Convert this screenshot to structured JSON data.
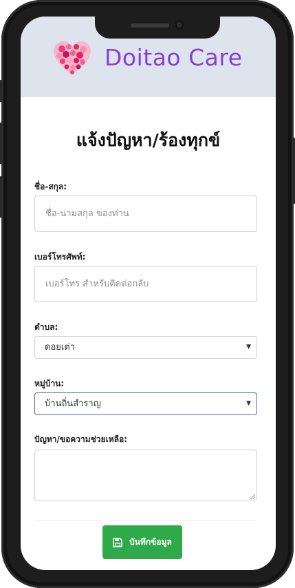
{
  "brand": {
    "name": "Doitao Care"
  },
  "page": {
    "title": "แจ้งปัญหา/ร้องทุกข์"
  },
  "form": {
    "name": {
      "label": "ชื่อ-สกุล:",
      "placeholder": "ชื่อ-นามสกุล ของท่าน",
      "value": ""
    },
    "phone": {
      "label": "เบอร์โทรศัพท์:",
      "placeholder": "เบอร์โทร สำหรับติดต่อกลับ",
      "value": ""
    },
    "subdistrict": {
      "label": "ตำบล:",
      "selected": "ดอยเต่า"
    },
    "village": {
      "label": "หมู่บ้าน:",
      "selected": "บ้านถิ่นสำราญ"
    },
    "issue": {
      "label": "ปัญหา/ขอความช่วยเหลือ:",
      "value": ""
    }
  },
  "actions": {
    "save_label": "บันทึกข้อมูล"
  },
  "icons": {
    "logo": "heart-logo-icon",
    "caret": "chevron-down-icon",
    "save": "floppy-disk-icon"
  },
  "colors": {
    "brand": "#8a3fd1",
    "header_bg": "#dde4ee",
    "save_button": "#2eaa4a",
    "focus_border": "#3e6aa8"
  }
}
